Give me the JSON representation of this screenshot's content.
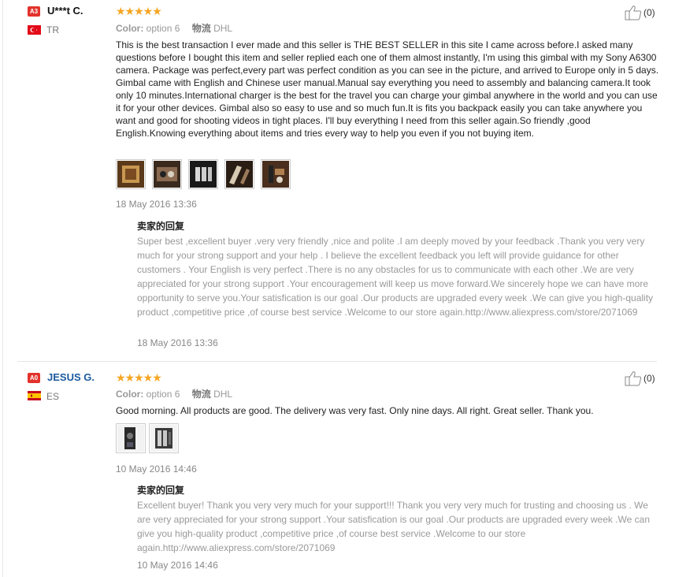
{
  "reviews": [
    {
      "buyer_level": "A3",
      "buyer_name": "U***t C.",
      "country": "TR",
      "rating_stars": 5,
      "stars_text": "★★★★★",
      "color_label": "Color:",
      "color_value": "option 6",
      "shipping_label": "物流",
      "shipping_value": "DHL",
      "text": "This is the best transaction I ever made and this seller is THE BEST SELLER in this site I came across before.I asked many questions before I bought this item and seller replied each one of them almost instantly, I'm using this gimbal with my Sony A6300 camera. Package was perfect,every part was perfect condition as you can see in the picture, and arrived to Europe only in 5 days. Gimbal came with English and Chinese user manual.Manual say everything you need to assembly and balancing camera.It took only 10 minutes.International charger is the best for the travel you can charge your gimbal anywhere in the world and you can use it for your other devices. Gimbal also so easy to use and so much fun.It is fits you backpack easily you can take anywhere you want and good for shooting videos in tight places. I'll buy everything I need from this seller again.So friendly ,good English.Knowing everything about items and tries every way to help you even if you not buying item.",
      "photo_count": 5,
      "date": "18 May 2016 13:36",
      "reply_title": "卖家的回复",
      "reply_text": "Super best ,excellent buyer .very very friendly ,nice and polite .I am deeply moved by your feedback .Thank you very very much for your strong support and your help . I believe the excellent feedback you left will provide guidance for other customers . Your English is very perfect .There is no any obstacles for us to communicate with each other .We are very appreciated for your strong support .Your encouragement will keep us move forward.We sincerely hope we can have more opportunity to serve you.Your satisfication is our goal .Our products are upgraded every week .We can give you high-quality product ,competitive price ,of course best service .Welcome to our store again.http://www.aliexpress.com/store/2071069",
      "reply_date": "18 May 2016 13:36",
      "helpful_count": "(0)"
    },
    {
      "buyer_level": "A0",
      "buyer_name": "JESUS G.",
      "country": "ES",
      "rating_stars": 5,
      "stars_text": "★★★★★",
      "color_label": "Color:",
      "color_value": "option 6",
      "shipping_label": "物流",
      "shipping_value": "DHL",
      "text": "Good morning. All products are good. The delivery was very fast. Only nine days. All right. Great seller. Thank you.",
      "photo_count": 2,
      "date": "10 May 2016 14:46",
      "reply_title": "卖家的回复",
      "reply_text": "Excellent buyer! Thank you very very much for your support!!! Thank you very very much for trusting and choosing us . We are very appreciated for your strong support .Your satisfication is our goal .Our products are upgraded every week .We can give you high-quality product ,competitive price ,of course best service .Welcome to our store again.http://www.aliexpress.com/store/2071069",
      "reply_date": "10 May 2016 14:46",
      "helpful_count": "(0)"
    }
  ],
  "colors": {
    "badge_red": "#e3322b",
    "star_orange": "#f5a623",
    "name_blue": "#1a5a9e",
    "reply_gray": "#999999"
  },
  "icons": {
    "thumbs_up": "thumbs-up-icon",
    "flag_tr": "turkey-flag-icon",
    "flag_es": "spain-flag-icon"
  }
}
